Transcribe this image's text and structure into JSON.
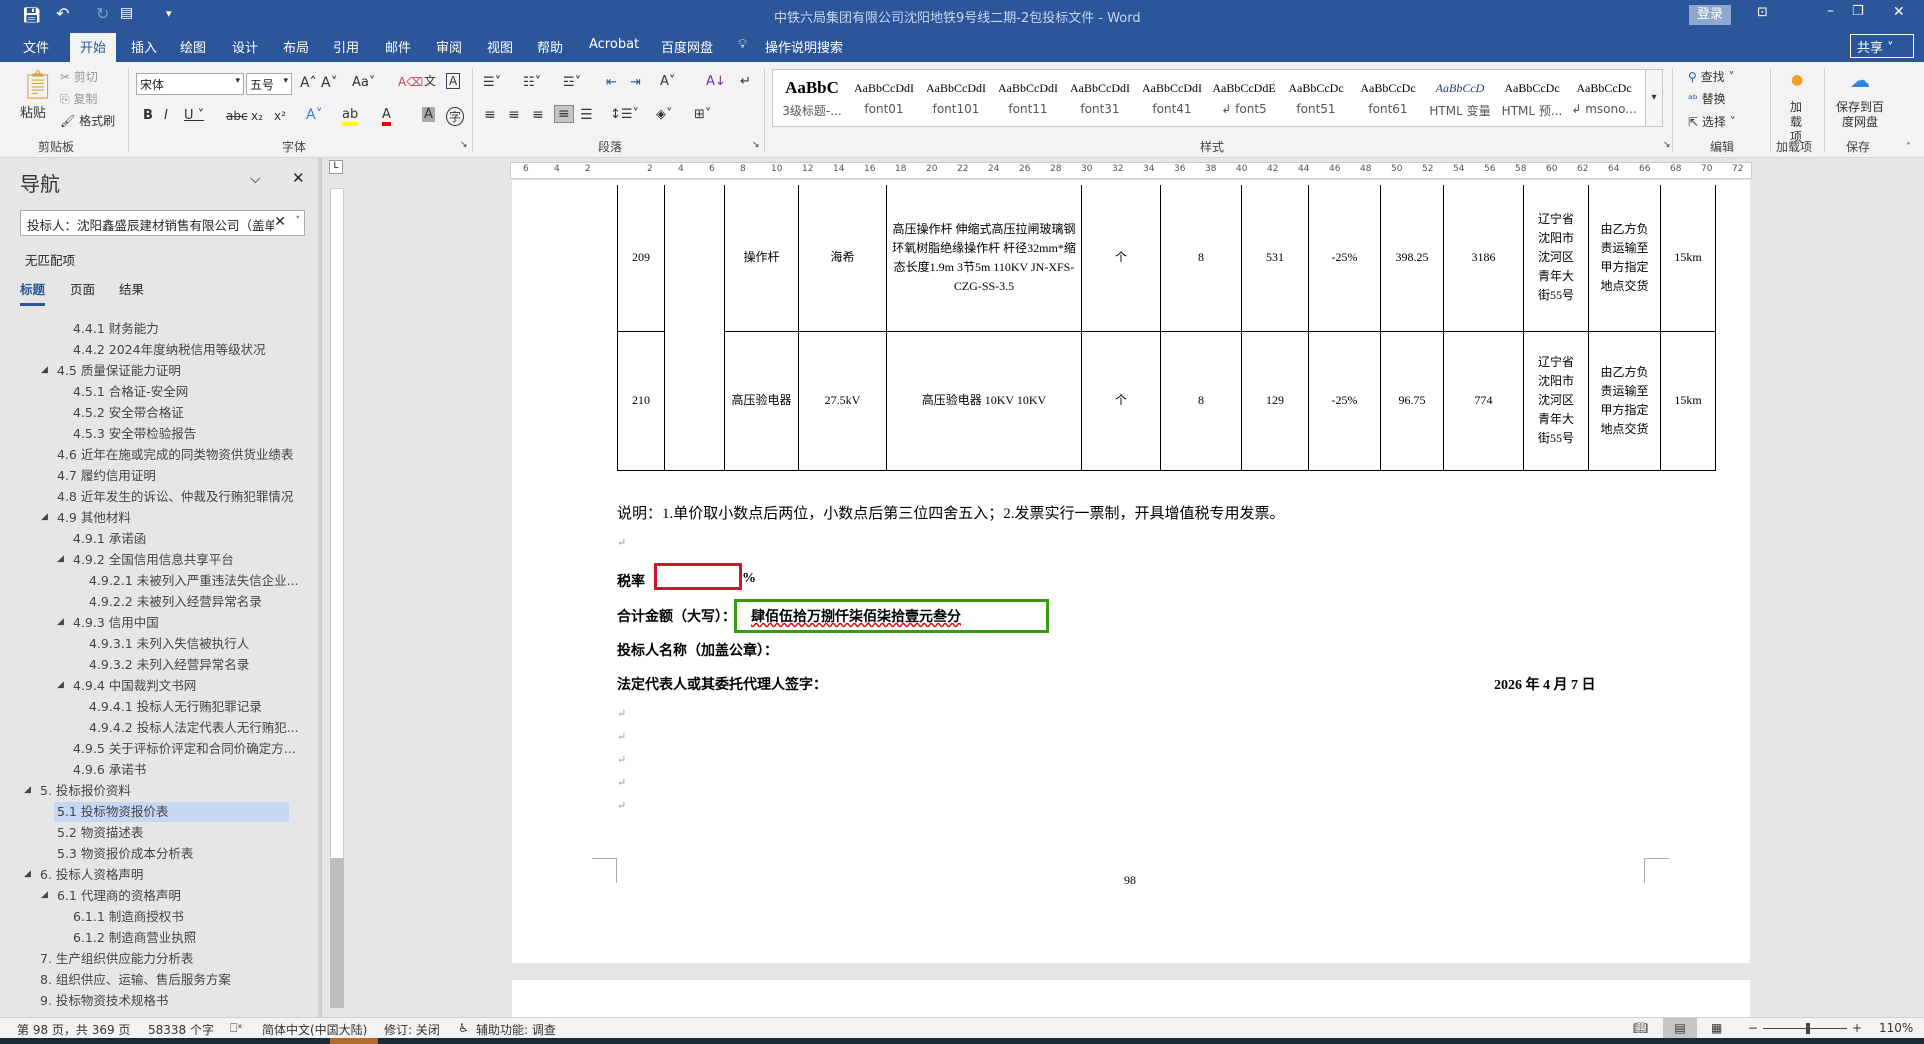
{
  "window": {
    "title": "中铁六局集团有限公司沈阳地铁9号线二期-2包投标文件  -  Word",
    "login": "登录",
    "share": "共享"
  },
  "tabs": [
    "文件",
    "开始",
    "插入",
    "绘图",
    "设计",
    "布局",
    "引用",
    "邮件",
    "审阅",
    "视图",
    "帮助",
    "Acrobat",
    "百度网盘"
  ],
  "tell_me": "操作说明搜索",
  "ribbon": {
    "clipboard": {
      "paste": "粘贴",
      "cut": "剪切",
      "copy": "复制",
      "format_painter": "格式刷",
      "label": "剪贴板"
    },
    "font": {
      "font_name": "宋体",
      "font_size": "五号",
      "label": "字体"
    },
    "paragraph": {
      "label": "段落"
    },
    "styles": {
      "label": "样式",
      "items": [
        {
          "preview": "AaBbC",
          "name": "3级标题-..."
        },
        {
          "preview": "AaBbCcDdI",
          "name": "font01"
        },
        {
          "preview": "AaBbCcDdI",
          "name": "font101"
        },
        {
          "preview": "AaBbCcDdI",
          "name": "font11"
        },
        {
          "preview": "AaBbCcDdI",
          "name": "font31"
        },
        {
          "preview": "AaBbCcDdI",
          "name": "font41"
        },
        {
          "preview": "AaBbCcDdE",
          "name": "↲ font5"
        },
        {
          "preview": "AaBbCcDc",
          "name": "font51"
        },
        {
          "preview": "AaBbCcDc",
          "name": "font61"
        },
        {
          "preview": "AaBbCcD",
          "name": "HTML 变量"
        },
        {
          "preview": "AaBbCcDc",
          "name": "HTML 预..."
        },
        {
          "preview": "AaBbCcDc",
          "name": "↲ msono..."
        }
      ]
    },
    "editing": {
      "find": "查找",
      "replace": "替换",
      "select": "选择",
      "label": "编辑"
    },
    "addins": {
      "button": "加载项",
      "label": "加载项"
    },
    "save": {
      "button": "保存到百度网盘",
      "label": "保存"
    }
  },
  "nav": {
    "title": "导航",
    "search_value": "投标人：沈阳鑫盛辰建材销售有限公司（盖单",
    "no_match": "无匹配项",
    "tabs": [
      "标题",
      "页面",
      "结果"
    ],
    "items": [
      {
        "text": "4.4.1 财务能力",
        "level": 2
      },
      {
        "text": "4.4.2 2024年度纳税信用等级状况",
        "level": 2
      },
      {
        "text": "4.5 质量保证能力证明",
        "level": 1,
        "expanded": true
      },
      {
        "text": "4.5.1 合格证-安全网",
        "level": 2
      },
      {
        "text": "4.5.2 安全带合格证",
        "level": 2
      },
      {
        "text": "4.5.3 安全带检验报告",
        "level": 2
      },
      {
        "text": "4.6 近年在施或完成的同类物资供货业绩表",
        "level": 1
      },
      {
        "text": "4.7 履约信用证明",
        "level": 1
      },
      {
        "text": "4.8 近年发生的诉讼、仲裁及行贿犯罪情况",
        "level": 1
      },
      {
        "text": "4.9 其他材料",
        "level": 1,
        "expanded": true
      },
      {
        "text": "4.9.1 承诺函",
        "level": 2
      },
      {
        "text": "4.9.2 全国信用信息共享平台",
        "level": 2,
        "expanded": true
      },
      {
        "text": "4.9.2.1 未被列入严重违法失信企业...",
        "level": 3
      },
      {
        "text": "4.9.2.2 未被列入经营异常名录",
        "level": 3
      },
      {
        "text": "4.9.3 信用中国",
        "level": 2,
        "expanded": true
      },
      {
        "text": "4.9.3.1 未列入失信被执行人",
        "level": 3
      },
      {
        "text": "4.9.3.2 未列入经营异常名录",
        "level": 3
      },
      {
        "text": "4.9.4 中国裁判文书网",
        "level": 2,
        "expanded": true
      },
      {
        "text": "4.9.4.1 投标人无行贿犯罪记录",
        "level": 3
      },
      {
        "text": "4.9.4.2 投标人法定代表人无行贿犯...",
        "level": 3
      },
      {
        "text": "4.9.5 关于评标价评定和合同价确定方...",
        "level": 2
      },
      {
        "text": "4.9.6 承诺书",
        "level": 2
      },
      {
        "text": "5. 投标报价资料",
        "level": 0,
        "expanded": true
      },
      {
        "text": "5.1 投标物资报价表",
        "level": 1,
        "selected": true
      },
      {
        "text": "5.2 物资描述表",
        "level": 1
      },
      {
        "text": "5.3 物资报价成本分析表",
        "level": 1
      },
      {
        "text": "6. 投标人资格声明",
        "level": 0,
        "expanded": true
      },
      {
        "text": "6.1 代理商的资格声明",
        "level": 1,
        "expanded": true
      },
      {
        "text": "6.1.1 制造商授权书",
        "level": 2
      },
      {
        "text": "6.1.2 制造商营业执照",
        "level": 2
      },
      {
        "text": "7. 生产组织供应能力分析表",
        "level": 0
      },
      {
        "text": "8. 组织供应、运输、售后服务方案",
        "level": 0
      },
      {
        "text": "9. 投标物资技术规格书",
        "level": 0
      }
    ]
  },
  "ruler": {
    "ticks": [
      "6",
      "4",
      "2",
      "",
      "2",
      "4",
      "6",
      "8",
      "10",
      "12",
      "14",
      "16",
      "18",
      "20",
      "22",
      "24",
      "26",
      "28",
      "30",
      "32",
      "34",
      "36",
      "38",
      "40",
      "42",
      "44",
      "46",
      "48",
      "50",
      "52",
      "54",
      "56",
      "58",
      "60",
      "62",
      "64",
      "66",
      "68",
      "70",
      "72"
    ]
  },
  "table": {
    "rows": [
      {
        "cells": [
          "209",
          "",
          "操作杆",
          "海希",
          "高压操作杆 伸缩式高压拉闸玻璃钢环氧树脂绝缘操作杆 杆径32mm*缩态长度1.9m 3节5m 110KV JN-XFS-CZG-SS-3.5",
          "个",
          "8",
          "531",
          "-25%",
          "398.25",
          "3186",
          "辽宁省沈阳市沈河区青年大街55号",
          "由乙方负责运输至甲方指定地点交货",
          "15km"
        ]
      },
      {
        "cells": [
          "210",
          "",
          "高压验电器",
          "27.5kV",
          "高压验电器 10KV 10KV",
          "个",
          "8",
          "129",
          "-25%",
          "96.75",
          "774",
          "辽宁省沈阳市沈河区青年大街55号",
          "由乙方负责运输至甲方指定地点交货",
          "15km"
        ]
      }
    ]
  },
  "doc": {
    "note": "说明：1.单价取小数点后两位，小数点后第三位四舍五入；2.发票实行一票制，开具增值税专用发票。",
    "tax_label": "税率",
    "tax_value": "",
    "tax_unit": "%",
    "total_label": "合计金额（大写）：",
    "total_value": "肆佰伍拾万捌仟柒佰柒拾壹元叁分",
    "bidder_label": "投标人名称（加盖公章）：",
    "rep_label": "法定代表人或其委托代理人签字：",
    "date": "2026 年 4 月 7 日",
    "page_number": "98",
    "highlight_colors": {
      "tax_box": "#d0162a",
      "total_box": "#3a9a10"
    }
  },
  "status": {
    "page": "第 98 页，共 369 页",
    "words": "58338 个字",
    "language": "简体中文(中国大陆)",
    "track": "修订: 关闭",
    "accessibility": "辅助功能: 调查",
    "zoom": "110%",
    "zoom_level": 110
  }
}
